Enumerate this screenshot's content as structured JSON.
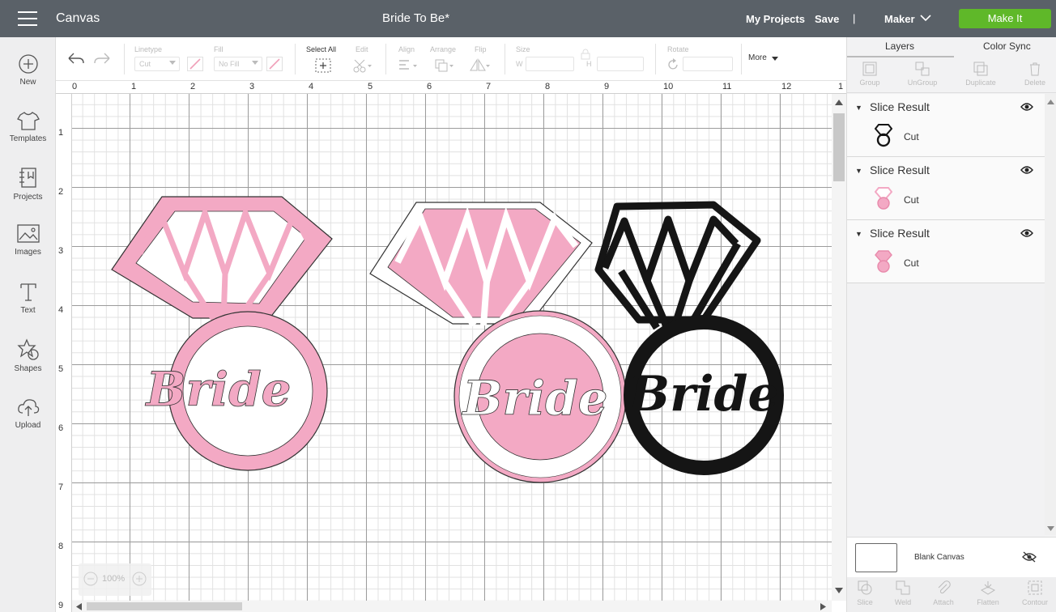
{
  "header": {
    "app_title": "Canvas",
    "doc_title": "Bride To Be*",
    "my_projects": "My Projects",
    "save": "Save",
    "separator": "|",
    "machine": "Maker",
    "make_it": "Make It"
  },
  "left_nav": [
    {
      "label": "New",
      "icon": "plus-circle-icon"
    },
    {
      "label": "Templates",
      "icon": "shirt-icon"
    },
    {
      "label": "Projects",
      "icon": "notebook-icon"
    },
    {
      "label": "Images",
      "icon": "image-icon"
    },
    {
      "label": "Text",
      "icon": "text-icon"
    },
    {
      "label": "Shapes",
      "icon": "shapes-icon"
    },
    {
      "label": "Upload",
      "icon": "cloud-upload-icon"
    }
  ],
  "toolbar": {
    "linetype_label": "Linetype",
    "linetype_value": "Cut",
    "fill_label": "Fill",
    "fill_value": "No Fill",
    "select_all": "Select All",
    "edit": "Edit",
    "align": "Align",
    "arrange": "Arrange",
    "flip": "Flip",
    "size": "Size",
    "w": "W",
    "h": "H",
    "rotate": "Rotate",
    "more": "More"
  },
  "ruler": {
    "h": [
      "0",
      "1",
      "2",
      "3",
      "4",
      "5",
      "6",
      "7",
      "8",
      "9",
      "10",
      "11",
      "12",
      "1"
    ],
    "v": [
      "1",
      "2",
      "3",
      "4",
      "5",
      "6",
      "7",
      "8",
      "9"
    ]
  },
  "zoom_level": "100%",
  "canvas_text": [
    "Bride",
    "Bride",
    "Bride"
  ],
  "colors": {
    "pink": "#f3a9c4",
    "black": "#151515",
    "make_it": "#5fb829",
    "topbar": "#5a6168"
  },
  "right_panel": {
    "tab_layers": "Layers",
    "tab_color_sync": "Color Sync",
    "actions": [
      "Group",
      "UnGroup",
      "Duplicate",
      "Delete"
    ],
    "layers": [
      {
        "name": "Slice Result",
        "type": "Cut",
        "color": "#151515"
      },
      {
        "name": "Slice Result",
        "type": "Cut",
        "color": "#f3a9c4"
      },
      {
        "name": "Slice Result",
        "type": "Cut",
        "color": "#f3a9c4"
      }
    ],
    "blank_canvas": "Blank Canvas",
    "bottom_actions": [
      "Slice",
      "Weld",
      "Attach",
      "Flatten",
      "Contour"
    ]
  }
}
